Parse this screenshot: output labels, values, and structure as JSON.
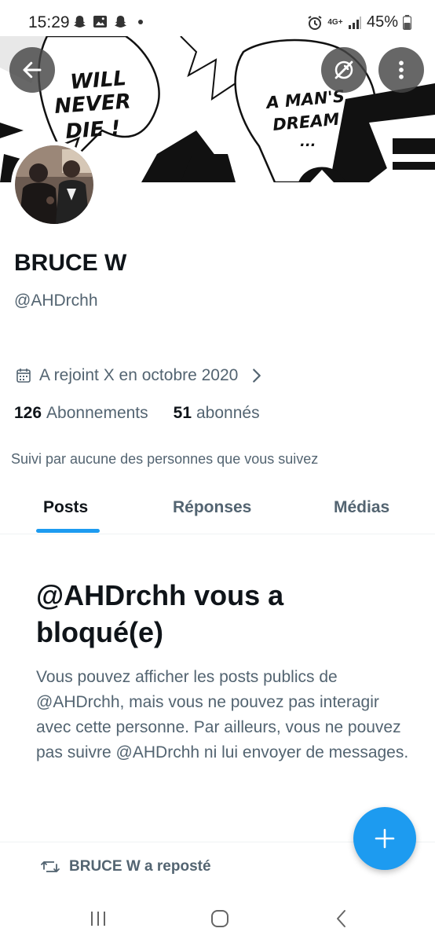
{
  "status_bar": {
    "time": "15:29",
    "network": "4G+",
    "battery": "45%"
  },
  "banner": {
    "bubble_left": [
      "WILL",
      "NEVER",
      "DIE !"
    ],
    "bubble_right": [
      "A MAN'S",
      "DREAM",
      "..."
    ]
  },
  "profile": {
    "display_name": "BRUCE W",
    "handle": "@AHDrchh",
    "joined": "A rejoint X en octobre 2020",
    "following_count": "126",
    "following_label": "Abonnements",
    "followers_count": "51",
    "followers_label": "abonnés",
    "followed_by": "Suivi par aucune des personnes que vous suivez"
  },
  "tabs": [
    {
      "label": "Posts",
      "active": true
    },
    {
      "label": "Réponses",
      "active": false
    },
    {
      "label": "Médias",
      "active": false
    }
  ],
  "blocked": {
    "title": "@AHDrchh vous a bloqué(e)",
    "body": "Vous pouvez afficher les posts publics de @AHDrchh, mais vous ne pouvez pas interagir avec cette personne. Par ailleurs, vous ne pouvez pas suivre @AHDrchh ni lui envoyer de messages."
  },
  "repost": {
    "text": "BRUCE W a reposté"
  },
  "colors": {
    "accent": "#1d9bf0",
    "text_primary": "#0f1419",
    "text_secondary": "#536471"
  },
  "icons": {
    "back": "arrow-left-icon",
    "hide_banner": "eye-slash-icon",
    "more": "more-vertical-icon",
    "calendar": "calendar-icon",
    "chevron": "chevron-right-icon",
    "repost": "repost-icon",
    "compose": "plus-icon"
  }
}
